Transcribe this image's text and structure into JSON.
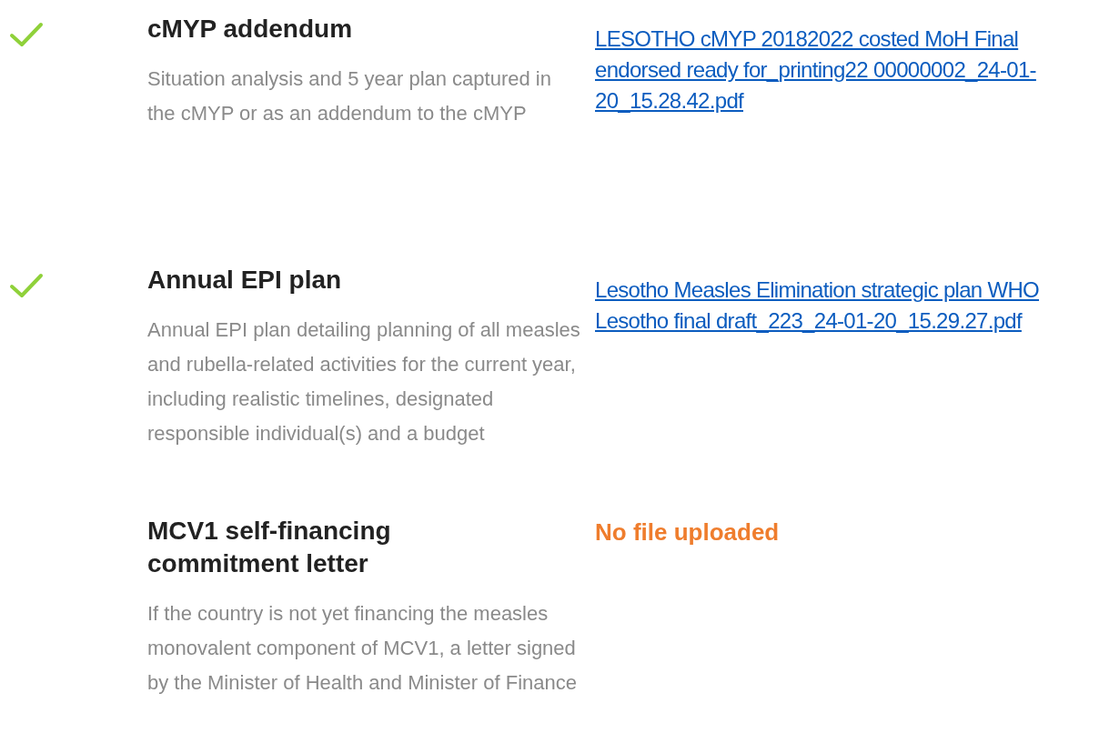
{
  "documents": [
    {
      "checked": true,
      "title": "cMYP addendum",
      "description": "Situation analysis and 5 year plan captured in the cMYP or as an addendum to the cMYP",
      "file": {
        "kind": "link",
        "text": "LESOTHO cMYP 20182022 costed MoH Final endorsed ready for_printing22 00000002_24-01-20_15.28.42.pdf"
      }
    },
    {
      "checked": true,
      "title": "Annual EPI plan",
      "description": "Annual EPI plan detailing planning of all measles and rubella-related activities for the current year, including realistic timelines, designated responsible individual(s) and a budget",
      "file": {
        "kind": "link",
        "text": "Lesotho Measles Elimination strategic plan WHO Lesotho final draft_223_24-01-20_15.29.27.pdf"
      }
    },
    {
      "checked": false,
      "title": "MCV1 self-financing commitment letter",
      "description": "If the country is not yet financing the measles monovalent component of MCV1, a letter signed by the Minister of Health and Minister of Finance",
      "file": {
        "kind": "missing",
        "text": "No file uploaded"
      }
    }
  ]
}
